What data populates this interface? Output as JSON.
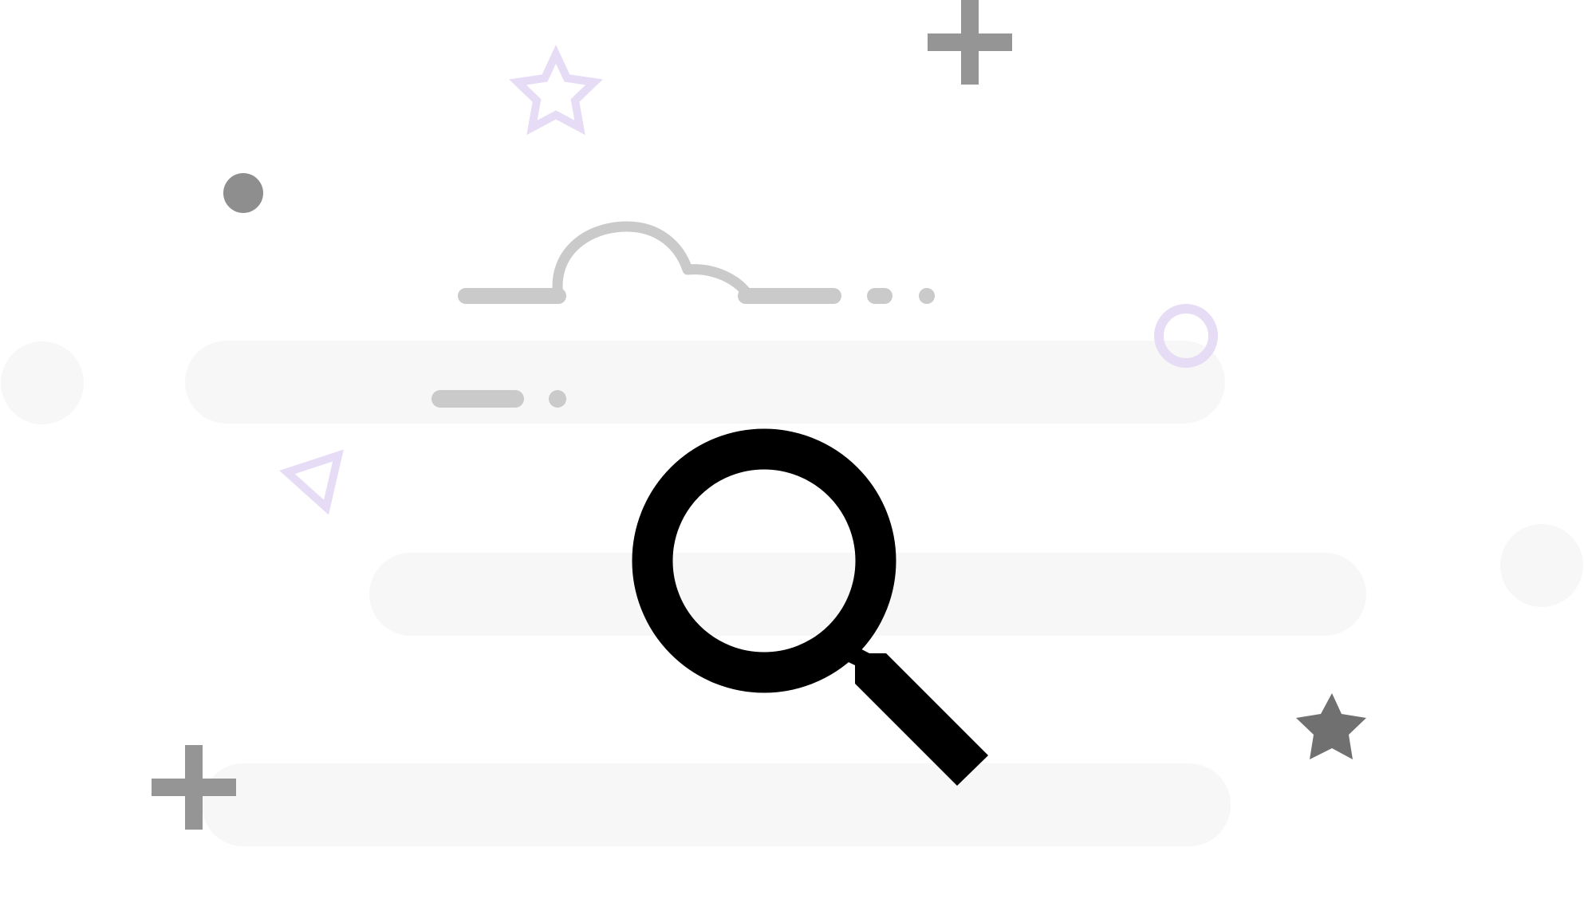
{
  "scene": {
    "name": "empty-search-illustration",
    "colors": {
      "background": "#ffffff",
      "bar_fill": "#f7f7f7",
      "line_gray": "#cacaca",
      "mid_gray": "#959595",
      "dark_gray": "#8e8e8e",
      "star_dark": "#707070",
      "lavender": "#e6dcf5",
      "magnifier": "#000000"
    },
    "icons": [
      "magnifying-glass-icon",
      "cloud-outline-icon",
      "plus-icon",
      "star-outline-icon",
      "star-filled-icon",
      "triangle-outline-icon",
      "ring-icon",
      "dot-icon"
    ]
  }
}
